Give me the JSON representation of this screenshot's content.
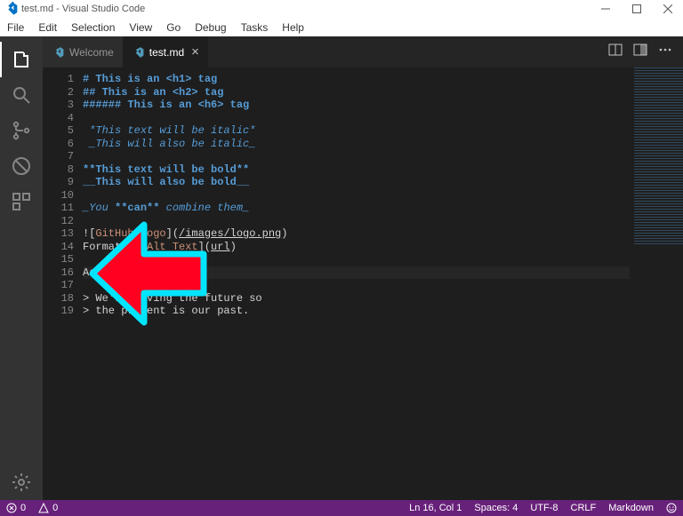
{
  "titlebar": {
    "title": "test.md - Visual Studio Code"
  },
  "menu": {
    "items": [
      "File",
      "Edit",
      "Selection",
      "View",
      "Go",
      "Debug",
      "Tasks",
      "Help"
    ]
  },
  "tabs": {
    "items": [
      {
        "label": "Welcome",
        "active": false
      },
      {
        "label": "test.md",
        "active": true
      }
    ]
  },
  "editor": {
    "lines": [
      {
        "n": 1,
        "segs": [
          {
            "t": "# This is an <h1> tag",
            "c": "c-hdr"
          }
        ]
      },
      {
        "n": 2,
        "segs": [
          {
            "t": "## This is an <h2> tag",
            "c": "c-hdr"
          }
        ]
      },
      {
        "n": 3,
        "segs": [
          {
            "t": "###### This is an <h6> tag",
            "c": "c-hdr"
          }
        ]
      },
      {
        "n": 4,
        "segs": [
          {
            "t": "",
            "c": ""
          }
        ]
      },
      {
        "n": 5,
        "segs": [
          {
            "t": " ",
            "c": ""
          },
          {
            "t": "*This text will be italic*",
            "c": "c-it"
          }
        ]
      },
      {
        "n": 6,
        "segs": [
          {
            "t": " ",
            "c": ""
          },
          {
            "t": "_This will also be italic_",
            "c": "c-it"
          }
        ]
      },
      {
        "n": 7,
        "segs": [
          {
            "t": "",
            "c": ""
          }
        ]
      },
      {
        "n": 8,
        "segs": [
          {
            "t": "**This text will be bold**",
            "c": "c-bd"
          }
        ]
      },
      {
        "n": 9,
        "segs": [
          {
            "t": "__This will also be bold__",
            "c": "c-bd"
          }
        ]
      },
      {
        "n": 10,
        "segs": [
          {
            "t": "",
            "c": ""
          }
        ]
      },
      {
        "n": 11,
        "segs": [
          {
            "t": "_You ",
            "c": "c-it"
          },
          {
            "t": "**can**",
            "c": "c-bd"
          },
          {
            "t": " combine them_",
            "c": "c-it"
          }
        ]
      },
      {
        "n": 12,
        "segs": [
          {
            "t": "",
            "c": ""
          }
        ]
      },
      {
        "n": 13,
        "segs": [
          {
            "t": "![",
            "c": ""
          },
          {
            "t": "GitHub Logo",
            "c": "c-str"
          },
          {
            "t": "](",
            "c": ""
          },
          {
            "t": "/images/logo.png",
            "c": "c-lk"
          },
          {
            "t": ")",
            "c": ""
          }
        ]
      },
      {
        "n": 14,
        "segs": [
          {
            "t": "Format: ![",
            "c": ""
          },
          {
            "t": "Alt Text",
            "c": "c-str"
          },
          {
            "t": "](",
            "c": ""
          },
          {
            "t": "url",
            "c": "c-lk"
          },
          {
            "t": ")",
            "c": ""
          }
        ]
      },
      {
        "n": 15,
        "segs": [
          {
            "t": "",
            "c": ""
          }
        ]
      },
      {
        "n": 16,
        "segs": [
          {
            "t": "As Kanye West said:",
            "c": ""
          }
        ],
        "current": true
      },
      {
        "n": 17,
        "segs": [
          {
            "t": "",
            "c": ""
          }
        ]
      },
      {
        "n": 18,
        "segs": [
          {
            "t": "> We're living the future so",
            "c": ""
          }
        ]
      },
      {
        "n": 19,
        "segs": [
          {
            "t": "> the present is our past.",
            "c": ""
          }
        ]
      }
    ]
  },
  "statusbar": {
    "errors": "0",
    "warnings": "0",
    "cursor": "Ln 16, Col 1",
    "spaces": "Spaces: 4",
    "encoding": "UTF-8",
    "eol": "CRLF",
    "language": "Markdown"
  },
  "arrow": {
    "fill": "#ff0020",
    "stroke": "#00e5ff"
  }
}
